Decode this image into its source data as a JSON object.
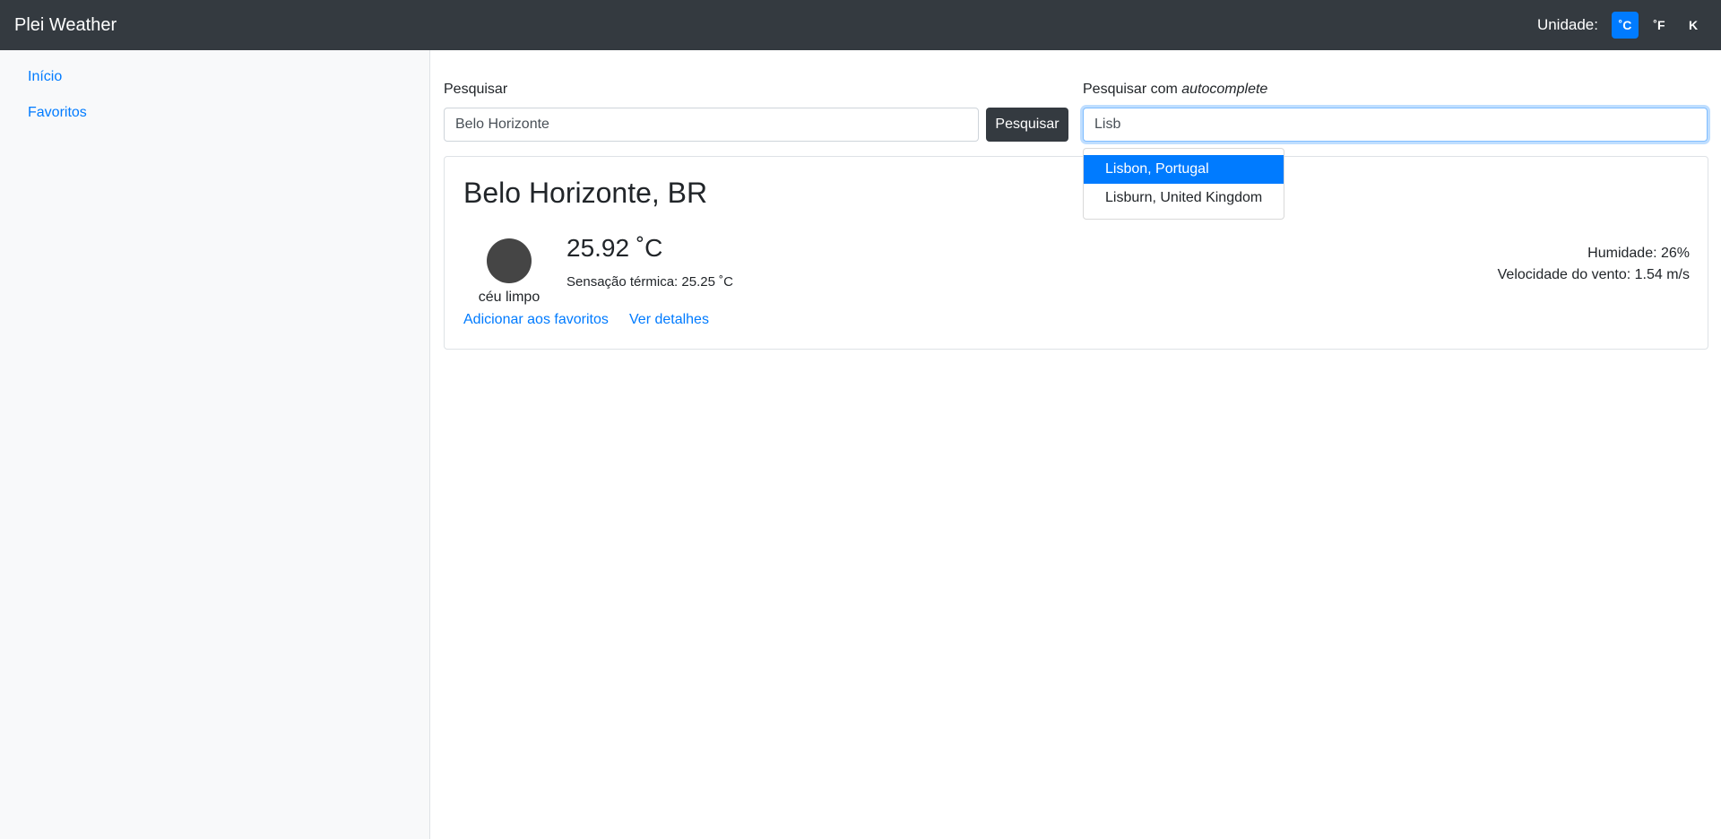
{
  "navbar": {
    "brand": "Plei Weather",
    "unit_label": "Unidade:",
    "units": [
      {
        "label": "˚C",
        "active": true
      },
      {
        "label": "˚F",
        "active": false
      },
      {
        "label": "K",
        "active": false
      }
    ]
  },
  "sidebar": {
    "items": [
      {
        "label": "Início"
      },
      {
        "label": "Favoritos"
      }
    ]
  },
  "search": {
    "label": "Pesquisar",
    "value": "Belo Horizonte",
    "button_label": "Pesquisar"
  },
  "autocomplete": {
    "label_prefix": "Pesquisar com ",
    "label_emphasis": "autocomplete",
    "value": "Lisb",
    "suggestions": [
      {
        "label": "Lisbon, Portugal",
        "highlighted": true
      },
      {
        "label": "Lisburn, United Kingdom",
        "highlighted": false
      }
    ]
  },
  "weather": {
    "city": "Belo Horizonte, BR",
    "icon": "clear-sky-icon",
    "description": "céu limpo",
    "temperature": "25.92 ˚C",
    "feels_like": "Sensação térmica: 25.25 ˚C",
    "humidity": "Humidade: 26%",
    "wind": "Velocidade do vento: 1.54 m/s",
    "add_favorite_label": "Adicionar aos favoritos",
    "details_label": "Ver detalhes"
  },
  "colors": {
    "navbar_bg": "#343a40",
    "accent": "#007bff",
    "sidebar_bg": "#f8f9fa"
  }
}
